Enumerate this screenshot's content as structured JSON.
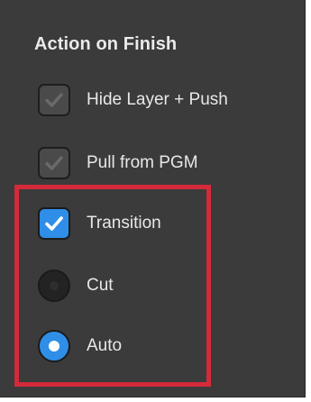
{
  "section": {
    "title": "Action on Finish"
  },
  "options": {
    "hide_layer_push": {
      "label": "Hide Layer + Push",
      "checked": true,
      "enabled": false
    },
    "pull_from_pgm": {
      "label": "Pull from PGM",
      "checked": true,
      "enabled": false
    },
    "transition": {
      "label": "Transition",
      "checked": true,
      "enabled": true
    },
    "cut": {
      "label": "Cut",
      "selected": false
    },
    "auto": {
      "label": "Auto",
      "selected": true
    }
  },
  "colors": {
    "panel_bg": "#3b3b3b",
    "accent_blue": "#2f8ee8",
    "highlight_red": "#d42a3a"
  }
}
